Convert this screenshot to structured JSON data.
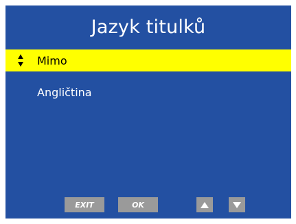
{
  "dialog": {
    "title": "Jazyk titulků"
  },
  "options": [
    {
      "label": "Mimo",
      "selected": true
    },
    {
      "label": "Angličtina",
      "selected": false
    }
  ],
  "footer": {
    "exit_label": "EXIT",
    "ok_label": "OK",
    "up_icon": "arrow-up-icon",
    "down_icon": "arrow-down-icon"
  },
  "colors": {
    "background": "#2350a2",
    "highlight": "#ffff00",
    "button": "#9a9a9a",
    "text": "#ffffff"
  }
}
